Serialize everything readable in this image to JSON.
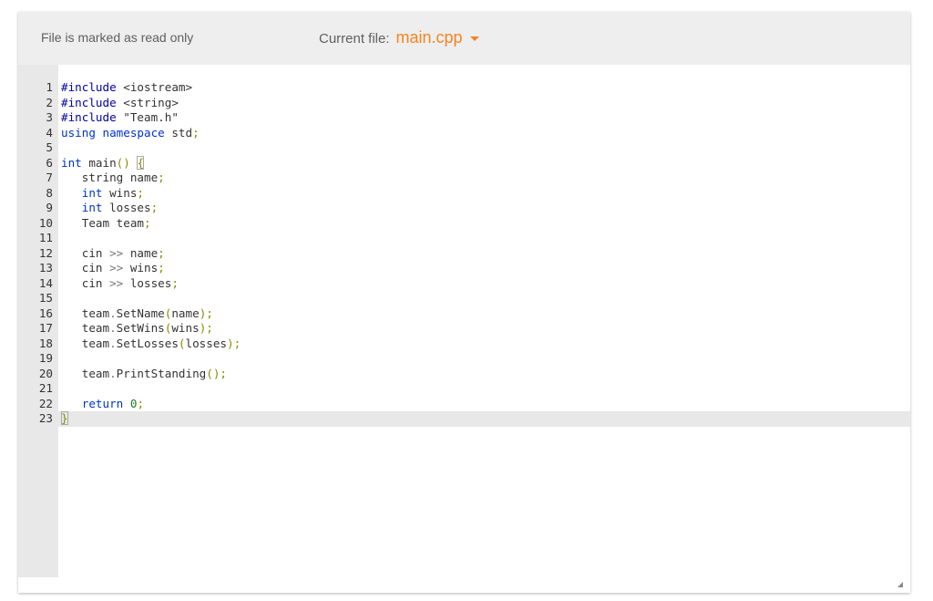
{
  "header": {
    "readonly_notice": "File is marked as read only",
    "current_file_label": "Current file:",
    "current_file_name": "main.cpp"
  },
  "editor": {
    "active_line": 23,
    "lines": [
      {
        "n": "1",
        "tokens": [
          {
            "t": "#include",
            "c": "pp"
          },
          {
            "t": " "
          },
          {
            "t": "<iostream>",
            "c": "str"
          }
        ]
      },
      {
        "n": "2",
        "tokens": [
          {
            "t": "#include",
            "c": "pp"
          },
          {
            "t": " "
          },
          {
            "t": "<string>",
            "c": "str"
          }
        ]
      },
      {
        "n": "3",
        "tokens": [
          {
            "t": "#include",
            "c": "pp"
          },
          {
            "t": " "
          },
          {
            "t": "\"Team.h\"",
            "c": "str"
          }
        ]
      },
      {
        "n": "4",
        "tokens": [
          {
            "t": "using",
            "c": "kw"
          },
          {
            "t": " "
          },
          {
            "t": "namespace",
            "c": "kw"
          },
          {
            "t": " std"
          },
          {
            "t": ";",
            "c": "pn"
          }
        ]
      },
      {
        "n": "5",
        "tokens": []
      },
      {
        "n": "6",
        "tokens": [
          {
            "t": "int",
            "c": "kw"
          },
          {
            "t": " main"
          },
          {
            "t": "()",
            "c": "pn"
          },
          {
            "t": " "
          },
          {
            "t": "{",
            "c": "pn brace"
          }
        ]
      },
      {
        "n": "7",
        "tokens": [
          {
            "t": "   string name"
          },
          {
            "t": ";",
            "c": "pn"
          }
        ]
      },
      {
        "n": "8",
        "tokens": [
          {
            "t": "   "
          },
          {
            "t": "int",
            "c": "kw"
          },
          {
            "t": " wins"
          },
          {
            "t": ";",
            "c": "pn"
          }
        ]
      },
      {
        "n": "9",
        "tokens": [
          {
            "t": "   "
          },
          {
            "t": "int",
            "c": "kw"
          },
          {
            "t": " losses"
          },
          {
            "t": ";",
            "c": "pn"
          }
        ]
      },
      {
        "n": "10",
        "tokens": [
          {
            "t": "   Team team"
          },
          {
            "t": ";",
            "c": "pn"
          }
        ]
      },
      {
        "n": "11",
        "tokens": []
      },
      {
        "n": "12",
        "tokens": [
          {
            "t": "   cin "
          },
          {
            "t": ">>",
            "c": "op"
          },
          {
            "t": " name"
          },
          {
            "t": ";",
            "c": "pn"
          }
        ]
      },
      {
        "n": "13",
        "tokens": [
          {
            "t": "   cin "
          },
          {
            "t": ">>",
            "c": "op"
          },
          {
            "t": " wins"
          },
          {
            "t": ";",
            "c": "pn"
          }
        ]
      },
      {
        "n": "14",
        "tokens": [
          {
            "t": "   cin "
          },
          {
            "t": ">>",
            "c": "op"
          },
          {
            "t": " losses"
          },
          {
            "t": ";",
            "c": "pn"
          }
        ]
      },
      {
        "n": "15",
        "tokens": []
      },
      {
        "n": "16",
        "tokens": [
          {
            "t": "   team"
          },
          {
            "t": ".",
            "c": "op"
          },
          {
            "t": "SetName"
          },
          {
            "t": "(",
            "c": "pn"
          },
          {
            "t": "name"
          },
          {
            "t": ");",
            "c": "pn"
          }
        ]
      },
      {
        "n": "17",
        "tokens": [
          {
            "t": "   team"
          },
          {
            "t": ".",
            "c": "op"
          },
          {
            "t": "SetWins"
          },
          {
            "t": "(",
            "c": "pn"
          },
          {
            "t": "wins"
          },
          {
            "t": ");",
            "c": "pn"
          }
        ]
      },
      {
        "n": "18",
        "tokens": [
          {
            "t": "   team"
          },
          {
            "t": ".",
            "c": "op"
          },
          {
            "t": "SetLosses"
          },
          {
            "t": "(",
            "c": "pn"
          },
          {
            "t": "losses"
          },
          {
            "t": ");",
            "c": "pn"
          }
        ]
      },
      {
        "n": "19",
        "tokens": []
      },
      {
        "n": "20",
        "tokens": [
          {
            "t": "   team"
          },
          {
            "t": ".",
            "c": "op"
          },
          {
            "t": "PrintStanding"
          },
          {
            "t": "();",
            "c": "pn"
          }
        ]
      },
      {
        "n": "21",
        "tokens": []
      },
      {
        "n": "22",
        "tokens": [
          {
            "t": "   "
          },
          {
            "t": "return",
            "c": "kw"
          },
          {
            "t": " "
          },
          {
            "t": "0",
            "c": "num"
          },
          {
            "t": ";",
            "c": "pn"
          }
        ]
      },
      {
        "n": "23",
        "tokens": [
          {
            "t": "}",
            "c": "pn brace"
          }
        ]
      }
    ]
  },
  "colors": {
    "accent": "#f5841f",
    "header_bg": "#eeeeee",
    "gutter_bg": "#e8e8e8",
    "keyword": "#0033cc"
  }
}
